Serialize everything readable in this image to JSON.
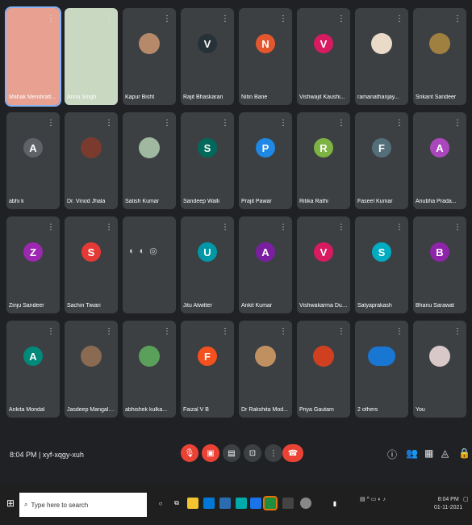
{
  "participants": [
    {
      "name": "Mahak Mendiratt...",
      "kind": "video",
      "color": "#e8a090"
    },
    {
      "name": "Annu Singh",
      "kind": "video",
      "color": "#c9d8c0"
    },
    {
      "name": "Kapur Bisht",
      "kind": "photo",
      "color": "#b5896a"
    },
    {
      "name": "Rajit Bhaskaran",
      "kind": "initial",
      "initial": "V",
      "color": "#263238"
    },
    {
      "name": "Nitin Bane",
      "kind": "initial",
      "initial": "N",
      "color": "#e4572e"
    },
    {
      "name": "Vishwajit Kaushi...",
      "kind": "initial",
      "initial": "V",
      "color": "#d81b60"
    },
    {
      "name": "ramanathanjay...",
      "kind": "photo",
      "color": "#eadbc8"
    },
    {
      "name": "Srikant Sandeer",
      "kind": "photo",
      "color": "#a08040"
    },
    {
      "name": "abhi k",
      "kind": "initial",
      "initial": "A",
      "color": "#5f6368"
    },
    {
      "name": "Dr. Vinod Jhala",
      "kind": "photo",
      "color": "#7a3b2e"
    },
    {
      "name": "Satish Kumar",
      "kind": "photo",
      "color": "#a0b8a0"
    },
    {
      "name": "Sandeep Walli",
      "kind": "initial",
      "initial": "S",
      "color": "#00695c"
    },
    {
      "name": "Prajit Pawar",
      "kind": "initial",
      "initial": "P",
      "color": "#1e88e5"
    },
    {
      "name": "Ritika Rathi",
      "kind": "initial",
      "initial": "R",
      "color": "#7cb342"
    },
    {
      "name": "Faseel Kumar",
      "kind": "initial",
      "initial": "F",
      "color": "#546e7a"
    },
    {
      "name": "Anubha Prada...",
      "kind": "initial",
      "initial": "A",
      "color": "#ab47bc"
    },
    {
      "name": "Zinju Sandeer",
      "kind": "initial",
      "initial": "Z",
      "color": "#9c27b0"
    },
    {
      "name": "Sachin Tiwari",
      "kind": "initial",
      "initial": "S",
      "color": "#e53935"
    },
    {
      "name": "",
      "kind": "overflow",
      "color": "#3c4043"
    },
    {
      "name": "Jitu Atwitter",
      "kind": "initial",
      "initial": "U",
      "color": "#0097a7"
    },
    {
      "name": "Ankit Kumar",
      "kind": "initial",
      "initial": "A",
      "color": "#7b1fa2"
    },
    {
      "name": "Vishwakarma Dubey",
      "kind": "initial",
      "initial": "V",
      "color": "#d81b60"
    },
    {
      "name": "Satyaprakash",
      "kind": "initial",
      "initial": "S",
      "color": "#00acc1"
    },
    {
      "name": "Bhanu Sarawat",
      "kind": "initial",
      "initial": "B",
      "color": "#8e24aa"
    },
    {
      "name": "Ankita Mondal",
      "kind": "initial",
      "initial": "A",
      "color": "#00897b"
    },
    {
      "name": "Jasdeep Mangalo...",
      "kind": "photo",
      "color": "#8a6a50"
    },
    {
      "name": "abhishek kulka...",
      "kind": "photo",
      "color": "#5aa05a"
    },
    {
      "name": "Faizal V B",
      "kind": "initial",
      "initial": "F",
      "color": "#f4511e"
    },
    {
      "name": "Dr Rakshita Mod...",
      "kind": "photo",
      "color": "#c09060"
    },
    {
      "name": "Priya Gautam",
      "kind": "photo",
      "color": "#d04020"
    },
    {
      "name": "2 others",
      "kind": "group",
      "color": "#1976d2"
    },
    {
      "name": "You",
      "kind": "photo",
      "color": "#d8c8c8"
    }
  ],
  "meeting": {
    "time": "8:04 PM",
    "code": "| xyf-xqgy-xuh"
  },
  "taskbar": {
    "search_placeholder": "Type here to search",
    "clock_time": "8:04 PM",
    "clock_date": "01-11-2021"
  }
}
